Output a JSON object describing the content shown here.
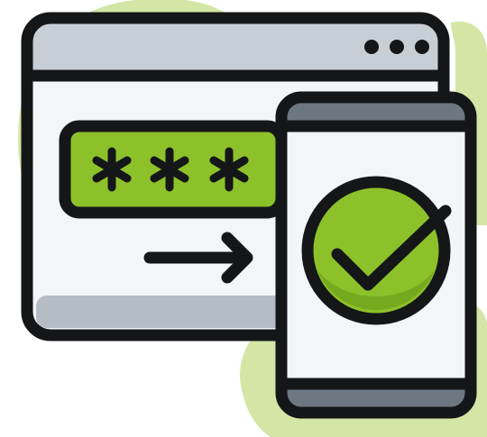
{
  "illustration": {
    "icon_names": [
      "browser-window-icon",
      "password-field-icon",
      "arrow-right-icon",
      "smartphone-icon",
      "checkmark-icon"
    ],
    "colors": {
      "blob": "#d4e6a5",
      "outline": "#141618",
      "window_title_bar": "#c7cfd6",
      "window_body": "#f3f5f7",
      "window_bottom_shade": "#b4bdc6",
      "password_field": "#8cc12a",
      "phone_band": "#6d7782",
      "phone_screen": "#f3f5f7",
      "check_circle": "#8cc12a",
      "check_circle_shade": "#76aa1e"
    },
    "password_mask_count": 3,
    "window_dot_count": 3
  }
}
